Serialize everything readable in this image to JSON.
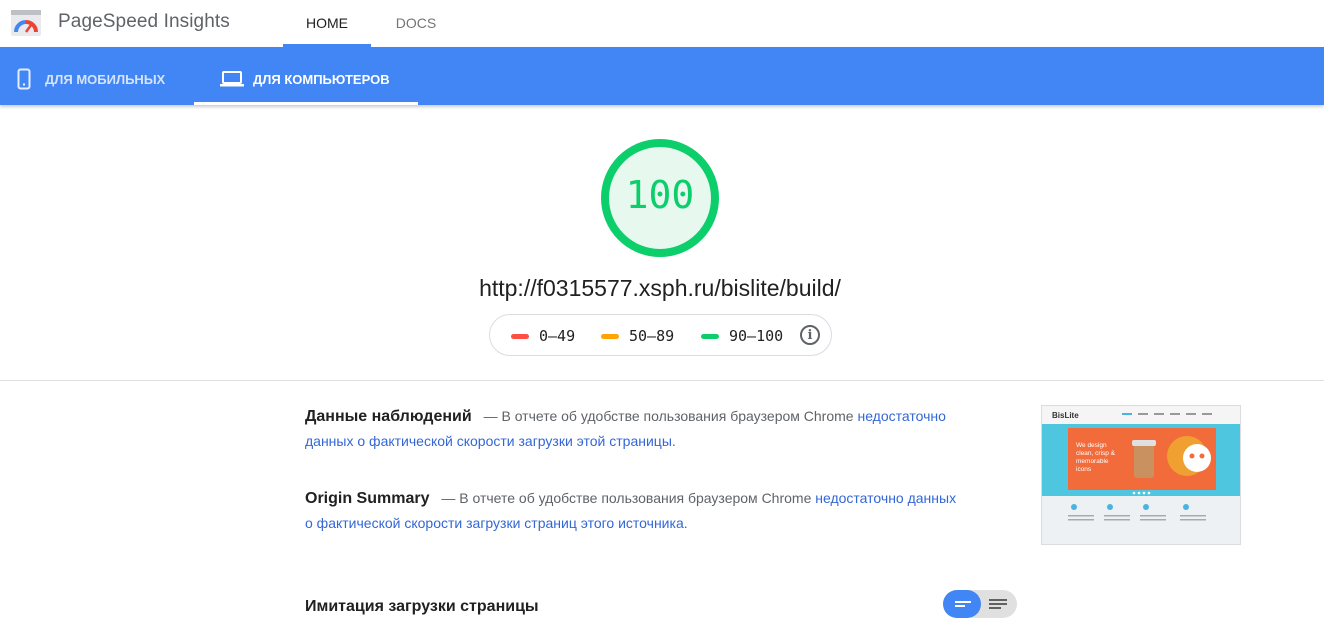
{
  "header": {
    "brand": "PageSpeed Insights",
    "tabs": [
      {
        "label": "HOME",
        "active": true
      },
      {
        "label": "DOCS",
        "active": false
      }
    ]
  },
  "device_tabs": [
    {
      "label": "ДЛЯ МОБИЛЬНЫХ",
      "icon": "smartphone-icon",
      "active": false
    },
    {
      "label": "ДЛЯ КОМПЬЮТЕРОВ",
      "icon": "laptop-icon",
      "active": true
    }
  ],
  "score": {
    "value": "100",
    "fraction": 1.0,
    "color": "#0cce6b"
  },
  "url": "http://f0315577.xsph.ru/bislite/build/",
  "legend": [
    {
      "label": "0–49",
      "color": "#ff4e42"
    },
    {
      "label": "50–89",
      "color": "#ffa400"
    },
    {
      "label": "90–100",
      "color": "#0cce6b"
    }
  ],
  "field_data": {
    "title": "Данные наблюдений",
    "dash": "—",
    "text": "В отчете об удобстве пользования браузером Chrome",
    "link": "недостаточно данных о фактической скорости загрузки этой страницы",
    "end": "."
  },
  "origin_summary": {
    "title": "Origin Summary",
    "dash": "—",
    "text": "В отчете об удобстве пользования браузером Chrome",
    "link": "недостаточно данных о фактической скорости загрузки страниц этого источника",
    "end": "."
  },
  "screenshot": {
    "logo": "BisLite",
    "hero_text": "We design clean, crisp & memorable icons"
  },
  "lab": {
    "title": "Имитация загрузки страницы"
  }
}
